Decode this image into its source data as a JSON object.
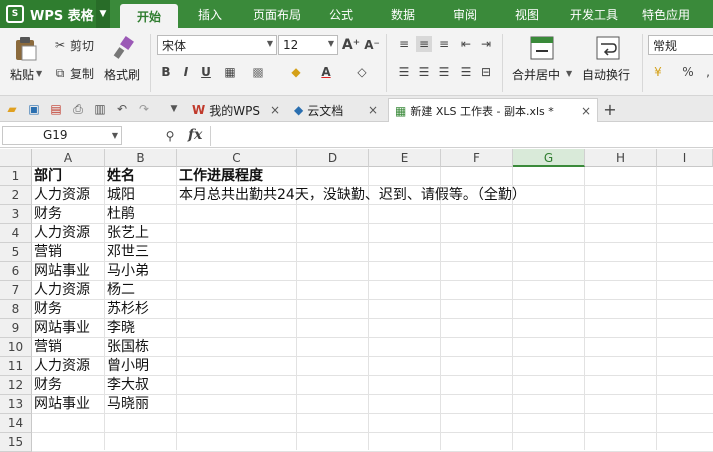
{
  "app": {
    "name": "WPS 表格"
  },
  "menu_tabs": [
    "开始",
    "插入",
    "页面布局",
    "公式",
    "数据",
    "审阅",
    "视图",
    "开发工具",
    "特色应用"
  ],
  "ribbon": {
    "paste": "粘贴",
    "cut": "剪切",
    "copy": "复制",
    "format_painter": "格式刷",
    "font_name": "宋体",
    "font_size": "12",
    "merge_center": "合并居中",
    "wrap_text": "自动换行",
    "number_format": "常规",
    "percent": "%"
  },
  "file_tabs": [
    {
      "label": "我的WPS"
    },
    {
      "label": "云文档"
    },
    {
      "label": "新建 XLS 工作表 - 副本.xls *"
    }
  ],
  "formula_bar": {
    "cell_ref": "G19",
    "fx": "fx",
    "value": ""
  },
  "columns": [
    "A",
    "B",
    "C",
    "D",
    "E",
    "F",
    "G",
    "H",
    "I"
  ],
  "selected_column": "G",
  "rows": [
    "1",
    "2",
    "3",
    "4",
    "5",
    "6",
    "7",
    "8",
    "9",
    "10",
    "11",
    "12",
    "13",
    "14",
    "15"
  ],
  "sheet": {
    "headers": {
      "a": "部门",
      "b": "姓名",
      "c": "工作进展程度"
    },
    "note_c2": "本月总共出勤共24天，没缺勤、迟到、请假等。（全勤）",
    "records": [
      {
        "dept": "人力资源",
        "name": "城阳"
      },
      {
        "dept": "财务",
        "name": "杜鹃"
      },
      {
        "dept": "人力资源",
        "name": "张艺上"
      },
      {
        "dept": "营销",
        "name": "邓世三"
      },
      {
        "dept": "网站事业",
        "name": "马小弟"
      },
      {
        "dept": "人力资源",
        "name": "杨二"
      },
      {
        "dept": "财务",
        "name": "苏杉杉"
      },
      {
        "dept": "网站事业",
        "name": "李晓"
      },
      {
        "dept": "营销",
        "name": "张国栋"
      },
      {
        "dept": "人力资源",
        "name": "曾小明"
      },
      {
        "dept": "财务",
        "name": "李大叔"
      },
      {
        "dept": "网站事业",
        "name": "马晓丽"
      }
    ]
  }
}
